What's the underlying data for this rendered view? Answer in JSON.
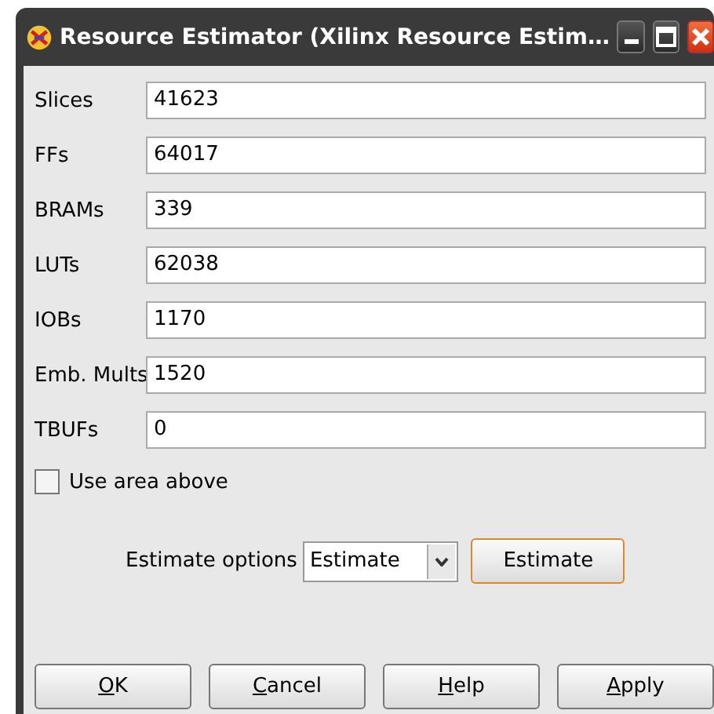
{
  "window": {
    "title": "Resource Estimator (Xilinx Resource Estim…"
  },
  "fields": [
    {
      "label": "Slices",
      "value": "41623"
    },
    {
      "label": "FFs",
      "value": "64017"
    },
    {
      "label": "BRAMs",
      "value": "339"
    },
    {
      "label": "LUTs",
      "value": "62038"
    },
    {
      "label": "IOBs",
      "value": "1170"
    },
    {
      "label": "Emb. Mults",
      "value": "1520"
    },
    {
      "label": "TBUFs",
      "value": "0"
    }
  ],
  "use_area_above": {
    "label": "Use area above",
    "checked": false
  },
  "estimate_options": {
    "label": "Estimate options",
    "value": "Estimate",
    "button": "Estimate"
  },
  "buttons": [
    {
      "accel": "O",
      "rest": "K"
    },
    {
      "accel": "C",
      "rest": "ancel"
    },
    {
      "accel": "H",
      "rest": "elp"
    },
    {
      "accel": "A",
      "rest": "pply"
    }
  ]
}
